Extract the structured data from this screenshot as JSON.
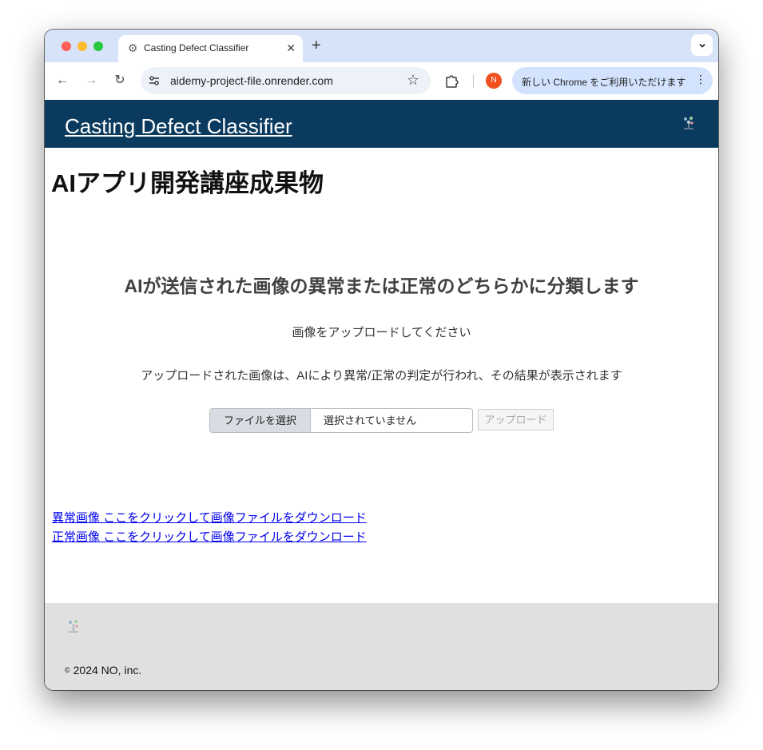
{
  "browser": {
    "tab": {
      "title": "Casting Defect Classifier",
      "favicon": "gear-icon",
      "close": "✕"
    },
    "new_tab": "+",
    "tab_search": "⌄",
    "back": "←",
    "forward": "→",
    "reload": "↻",
    "url": "aidemy-project-file.onrender.com",
    "bookmark": "☆",
    "profile_initial": "N",
    "promo_text": "新しい Chrome をご利用いただけます",
    "promo_menu": "⋮",
    "colors": {
      "tabstrip": "#d7e3f8",
      "omnibox": "#edf1f8",
      "promo": "#d3e3fd",
      "profile": "#f0501e"
    }
  },
  "site": {
    "brand": "Casting Defect Classifier",
    "heading": "AIアプリ開発講座成果物",
    "subheading": "AIが送信された画像の異常または正常のどちらかに分類します",
    "instruction": "画像をアップロードしてください",
    "description": "アップロードされた画像は、AIにより異常/正常の判定が行われ、その結果が表示されます",
    "file_button": "ファイルを選択",
    "file_status": "選択されていません",
    "upload_button": "アップロード",
    "links": [
      "異常画像 ここをクリックして画像ファイルをダウンロード",
      "正常画像 ここをクリックして画像ファイルをダウンロード"
    ],
    "copyright_symbol": "©",
    "copyright": "2024 NO, inc.",
    "colors": {
      "navbar": "#0a3a5e",
      "footer": "#e0e0e0",
      "link": "#0000ee"
    }
  }
}
